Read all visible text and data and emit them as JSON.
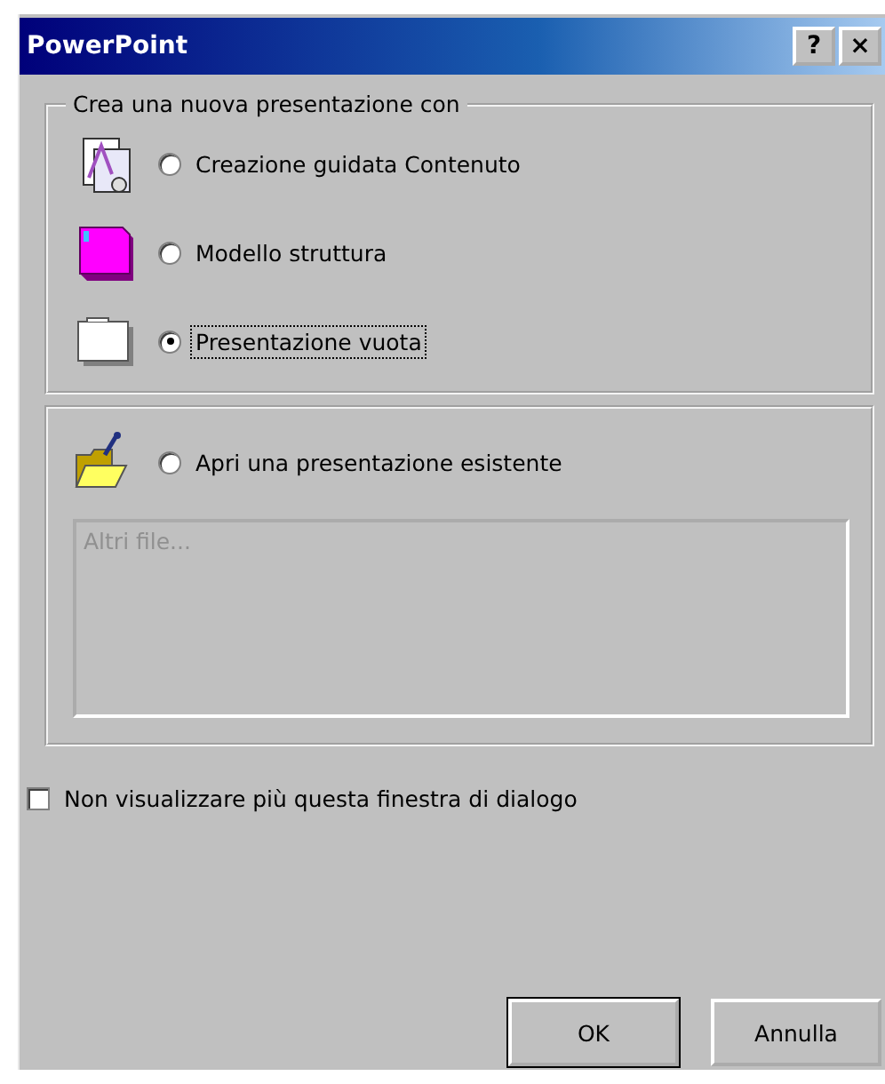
{
  "window": {
    "title": "PowerPoint",
    "title_buttons": [
      "?",
      "×"
    ]
  },
  "new_group": {
    "caption": "Crea una nuova presentazione con",
    "options": [
      {
        "kind": "wizard",
        "label": "Creazione guidata Contenuto",
        "selected": false
      },
      {
        "kind": "template",
        "label": "Modello struttura",
        "selected": false
      },
      {
        "kind": "blank",
        "label": "Presentazione vuota",
        "selected": true
      }
    ]
  },
  "open_group": {
    "option": {
      "kind": "open",
      "label": "Apri una presentazione esistente",
      "selected": false
    },
    "files": [
      {
        "label": "Altri file...",
        "disabled": true
      }
    ]
  },
  "dont_show": {
    "label": "Non visualizzare più questa finestra di dialogo",
    "checked": false
  },
  "buttons": [
    "OK",
    "Annulla"
  ]
}
